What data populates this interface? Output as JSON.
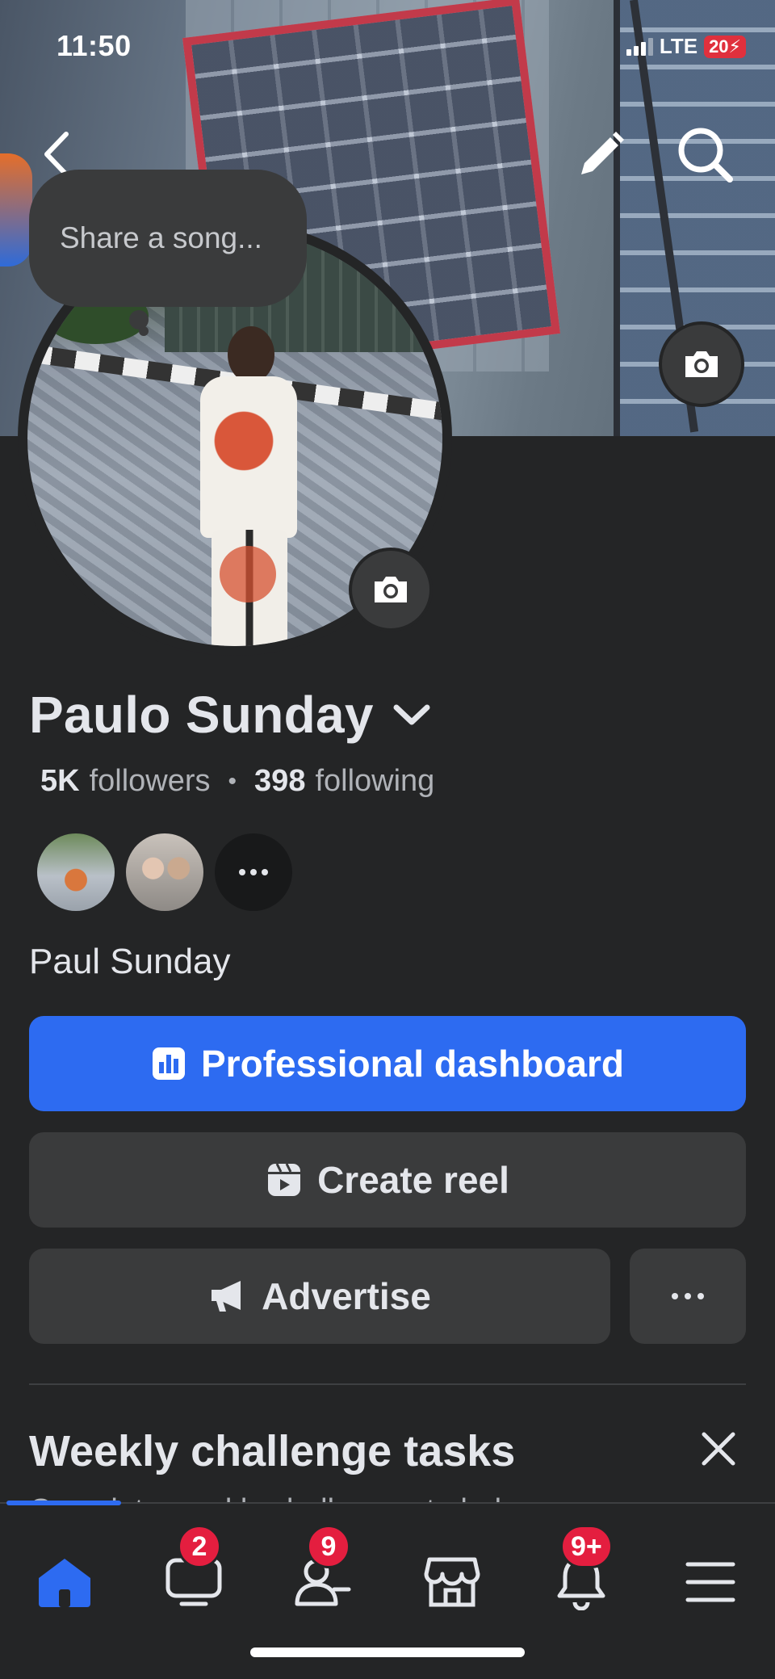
{
  "status_bar": {
    "time": "11:50",
    "network": "LTE",
    "battery": "20"
  },
  "header": {
    "back_icon": "chevron-left-icon",
    "edit_icon": "pencil-icon",
    "search_icon": "search-icon"
  },
  "song_prompt": {
    "placeholder": "Share a song..."
  },
  "profile": {
    "name": "Paulo Sunday",
    "followers_count": "5K",
    "followers_label": "followers",
    "following_count": "398",
    "following_label": "following",
    "secondary_name": "Paul Sunday"
  },
  "actions": {
    "professional_dashboard": "Professional dashboard",
    "create_reel": "Create reel",
    "advertise": "Advertise"
  },
  "weekly_challenge": {
    "title": "Weekly challenge tasks",
    "subtitle": "Complete weekly challenges to help"
  },
  "bottom_nav": {
    "items": [
      {
        "name": "home",
        "icon": "home-icon",
        "badge": ""
      },
      {
        "name": "video",
        "icon": "video-icon",
        "badge": "2"
      },
      {
        "name": "friends",
        "icon": "friends-icon",
        "badge": "9"
      },
      {
        "name": "marketplace",
        "icon": "marketplace-icon",
        "badge": ""
      },
      {
        "name": "notifications",
        "icon": "bell-icon",
        "badge": "9+"
      },
      {
        "name": "menu",
        "icon": "menu-icon",
        "badge": ""
      }
    ]
  },
  "colors": {
    "background": "#242526",
    "surface": "#3a3b3c",
    "accent": "#2d6bf1",
    "badge": "#e41e3f",
    "text_primary": "#e4e6eb",
    "text_secondary": "#b0b3b8"
  }
}
